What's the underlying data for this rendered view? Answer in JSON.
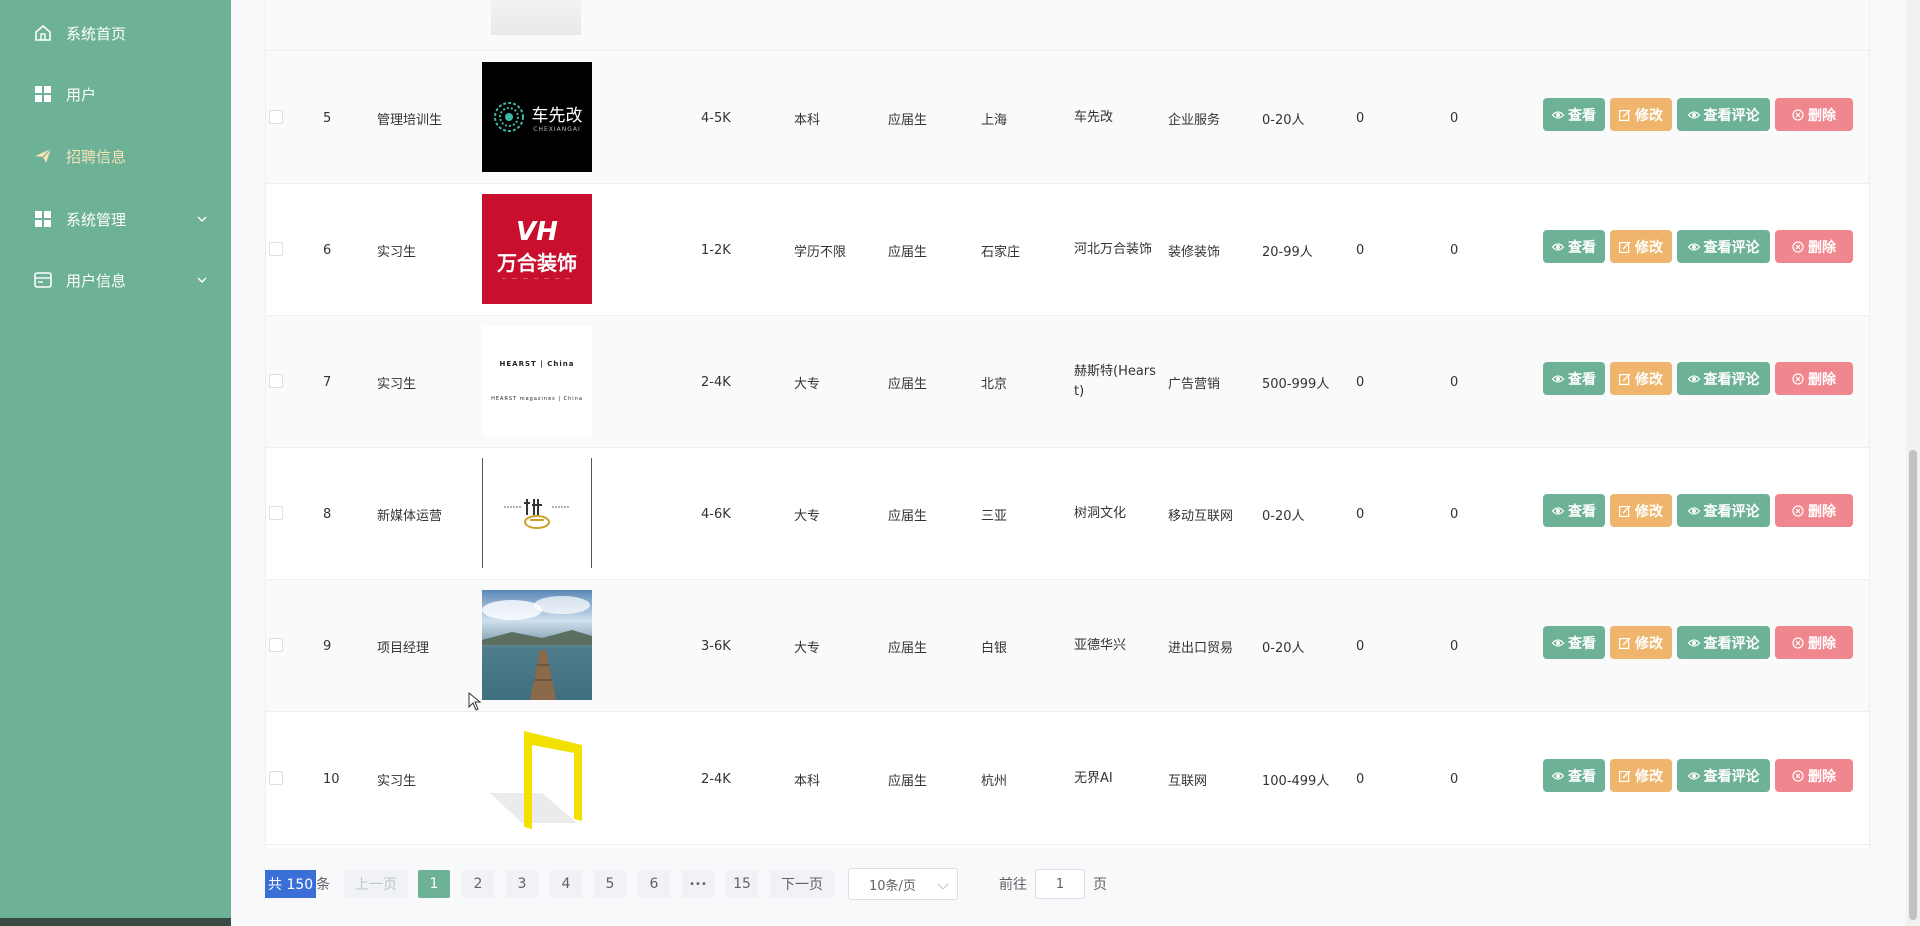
{
  "sidebar": {
    "items": [
      {
        "label": "系统首页",
        "icon": "home-icon"
      },
      {
        "label": "用户",
        "icon": "grid-icon"
      },
      {
        "label": "招聘信息",
        "icon": "send-icon",
        "active": true
      },
      {
        "label": "系统管理",
        "icon": "grid-icon",
        "expandable": true
      },
      {
        "label": "用户信息",
        "icon": "card-icon",
        "expandable": true
      }
    ]
  },
  "colors": {
    "sidebar": "#6db197",
    "active_menu_text": "#f5e3b5",
    "view_button": "#6db197",
    "edit_button": "#f0b56c",
    "delete_button": "#f1878e",
    "total_highlight": "#3a6fd8"
  },
  "actions": {
    "view": "查看",
    "edit": "修改",
    "review": "查看评论",
    "delete": "删除"
  },
  "rows": [
    {
      "index": "5",
      "title": "管理培训生",
      "salary": "4-5K",
      "education": "本科",
      "experience": "应届生",
      "city": "上海",
      "company": "车先改",
      "industry": "企业服务",
      "size": "0-20人",
      "col_a": "0",
      "col_b": "0",
      "logo": "chexiangai-logo",
      "logo_text_main": "车先改",
      "logo_text_sub": "CHEXIANGAI"
    },
    {
      "index": "6",
      "title": "实习生",
      "salary": "1-2K",
      "education": "学历不限",
      "experience": "应届生",
      "city": "石家庄",
      "company": "河北万合装饰",
      "industry": "装修装饰",
      "size": "20-99人",
      "col_a": "0",
      "col_b": "0",
      "logo": "wanhe-logo",
      "logo_text_main": "万合装饰",
      "logo_text_sub": "VH"
    },
    {
      "index": "7",
      "title": "实习生",
      "salary": "2-4K",
      "education": "大专",
      "experience": "应届生",
      "city": "北京",
      "company": "赫斯特(Hearst)",
      "industry": "广告营销",
      "size": "500-999人",
      "col_a": "0",
      "col_b": "0",
      "logo": "hearst-logo",
      "logo_text_main": "HEARST | China",
      "logo_text_sub": "HEARST magazines | China"
    },
    {
      "index": "8",
      "title": "新媒体运营",
      "salary": "4-6K",
      "education": "大专",
      "experience": "应届生",
      "city": "三亚",
      "company": "树洞文化",
      "industry": "移动互联网",
      "size": "0-20人",
      "col_a": "0",
      "col_b": "0",
      "logo": "shudong-logo",
      "logo_text_main": "",
      "logo_text_sub": ""
    },
    {
      "index": "9",
      "title": "项目经理",
      "salary": "3-6K",
      "education": "大专",
      "experience": "应届生",
      "city": "白银",
      "company": "亚德华兴",
      "industry": "进出口贸易",
      "size": "0-20人",
      "col_a": "0",
      "col_b": "0",
      "logo": "pier-photo",
      "logo_text_main": "",
      "logo_text_sub": ""
    },
    {
      "index": "10",
      "title": "实习生",
      "salary": "2-4K",
      "education": "本科",
      "experience": "应届生",
      "city": "杭州",
      "company": "无界AI",
      "industry": "互联网",
      "size": "100-499人",
      "col_a": "0",
      "col_b": "0",
      "logo": "wujie-logo",
      "logo_text_main": "",
      "logo_text_sub": ""
    }
  ],
  "pagination": {
    "total_prefix": "共 150",
    "total_suffix": "条",
    "prev": "上一页",
    "next": "下一页",
    "pages": [
      "1",
      "2",
      "3",
      "4",
      "5",
      "6",
      "•••",
      "15"
    ],
    "current": "1",
    "page_size": "10条/页",
    "goto_label": "前往",
    "goto_value": "1",
    "goto_suffix": "页"
  }
}
